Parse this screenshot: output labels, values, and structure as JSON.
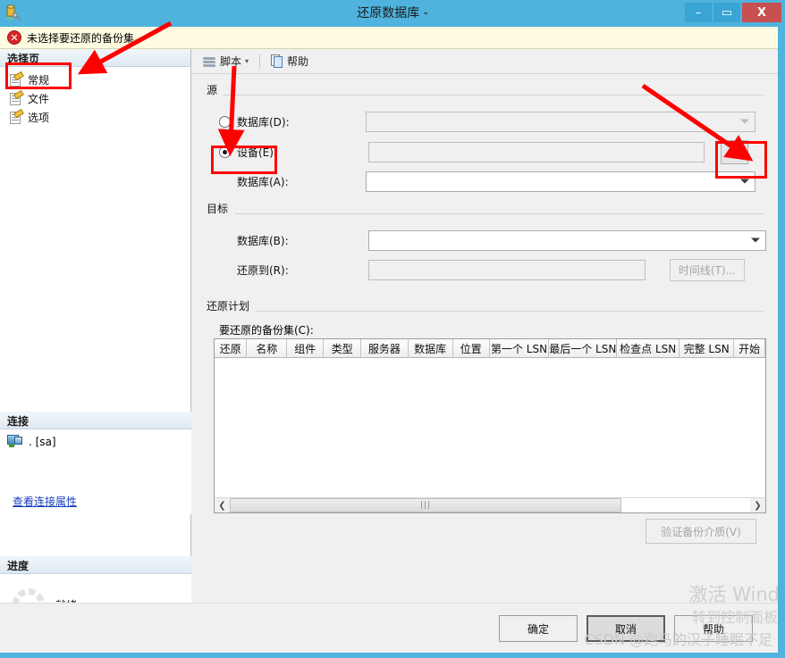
{
  "window": {
    "title": "还原数据库 -",
    "icon": "restore-database-icon",
    "minimize_label": "–",
    "maximize_label": "▭",
    "close_label": "X"
  },
  "infobar": {
    "icon": "error-icon",
    "icon_glyph": "✕",
    "message": "未选择要还原的备份集。"
  },
  "sidebar": {
    "header": "选择页",
    "items": [
      {
        "label": "常规",
        "icon": "page-general-icon",
        "selected": true
      },
      {
        "label": "文件",
        "icon": "page-files-icon",
        "selected": false
      },
      {
        "label": "选项",
        "icon": "page-options-icon",
        "selected": false
      }
    ],
    "connection": {
      "header": "连接",
      "server": ". [sa]",
      "link": "查看连接属性"
    },
    "progress": {
      "header": "进度",
      "status": "就绪"
    }
  },
  "toolbar": {
    "script_label": "脚本",
    "script_caret": "▾",
    "help_label": "帮助"
  },
  "source": {
    "group_title": "源",
    "database_radio_label": "数据库(D):",
    "database_radio_checked": false,
    "database_value": "",
    "device_radio_label": "设备(E):",
    "device_radio_checked": true,
    "device_value": "",
    "browse_button_label": "...",
    "source_db_label": "数据库(A):",
    "source_db_value": ""
  },
  "destination": {
    "group_title": "目标",
    "database_label": "数据库(B):",
    "database_value": "",
    "restore_to_label": "还原到(R):",
    "restore_to_value": "",
    "timeline_button_label": "时间线(T)..."
  },
  "restore_plan": {
    "group_title": "还原计划",
    "backupsets_label": "要还原的备份集(C):",
    "columns": [
      "还原",
      "名称",
      "组件",
      "类型",
      "服务器",
      "数据库",
      "位置",
      "第一个 LSN",
      "最后一个 LSN",
      "检查点 LSN",
      "完整 LSN",
      "开始"
    ],
    "rows": [],
    "verify_button_label": "验证备份介质(V)"
  },
  "footer": {
    "ok_label": "确定",
    "cancel_label": "取消",
    "help_label": "帮助"
  },
  "watermarks": {
    "activate_line1": "激活 Wind",
    "activate_line2": "转到控制面板",
    "csdn": "CSDN @跑马的汉子睡眠不足"
  },
  "colors": {
    "titlebar": "#4fb3dd",
    "close_button": "#c75050",
    "infobar_bg": "#fffbe1",
    "annotation": "#ff0000",
    "link": "#1a3fbf"
  }
}
